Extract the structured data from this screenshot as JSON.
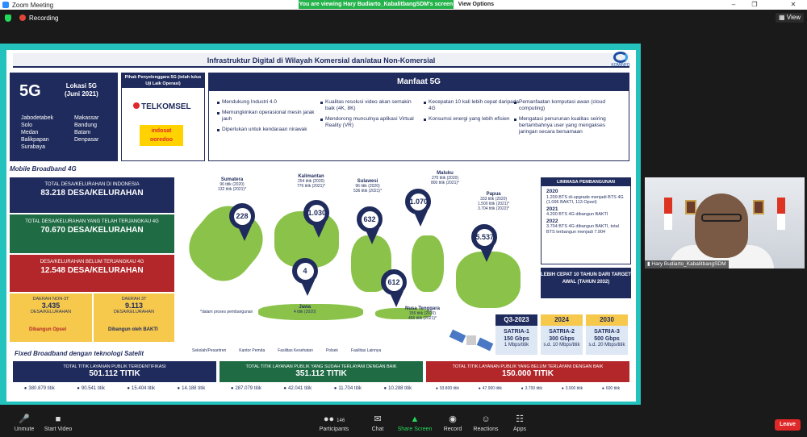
{
  "window": {
    "title": "Zoom Meeting"
  },
  "topbar": {
    "recording_label": "Recording",
    "view_label": "View"
  },
  "banner": {
    "viewing_text": "You are viewing Hary Budiarto_KabalitbangSDM's screen",
    "view_options_label": "View Options"
  },
  "slide": {
    "title": "Infrastruktur Digital di Wilayah Komersial dan/atau Non-Komersial",
    "logo_text": "KOMINFO",
    "fiveg": {
      "big": "5G",
      "lokasi": "Lokasi 5G",
      "date": "(Juni 2021)",
      "cities_left": [
        "Jabodetabek",
        "Solo",
        "Medan",
        "Balikpapan",
        "Surabaya"
      ],
      "cities_right": [
        "Makassar",
        "Bandung",
        "Batam",
        "Denpasar"
      ]
    },
    "operators": {
      "header": "Pihak Penyelenggara 5G (telah lulus Uji Laik Operasi)",
      "op1": "TELKOMSEL",
      "op2a": "indosat",
      "op2b": "ooredoo"
    },
    "manfaat": {
      "header": "Manfaat 5G",
      "col1": [
        "Mendukung Industri 4.0",
        "Memungkinkan operasional mesin jarak jauh",
        "Diperlukan untuk kendaraan nirawak"
      ],
      "col2": [
        "Kualitas resolusi video akan semakin baik (4K, 8K)",
        "Mendorong munculnya aplikasi Virtual Reality (VR)"
      ],
      "col3": [
        "Kecepatan 10 kali lebih cepat daripada 4G",
        "Konsumsi energi yang lebih efisien"
      ],
      "col4": [
        "Pemanfaatan komputasi awan (cloud computing)",
        "Mengatasi penurunan kualitas seiring bertambahnya user yang mengakses jaringan secara bersamaan"
      ]
    },
    "mobile_title": "Mobile Broadband 4G",
    "stats": [
      {
        "label": "TOTAL DESA/KELURAHAN DI INDONESIA",
        "value": "83.218 DESA/KELURAHAN"
      },
      {
        "label": "TOTAL DESA/KELURAHAN YANG TELAH TERJANGKAU 4G",
        "value": "70.670 DESA/KELURAHAN"
      },
      {
        "label": "DESA/KELURAHAN BELUM TERJANGKAU 4G",
        "value": "12.548 DESA/KELURAHAN"
      }
    ],
    "sub": {
      "non3t_label": "DAERAH NON-3T",
      "non3t_value": "3.435",
      "non3t_unit": "DESA/KELURAHAN",
      "non3t_note": "Dibangun Opsel",
      "t3_label": "DAERAH 3T",
      "t3_value": "9.113",
      "t3_unit": "DESA/KELURAHAN",
      "t3_note": "Dibangun oleh BAKTI"
    },
    "regions": [
      {
        "name": "Sumatera",
        "l1": "96 titik (2020)",
        "l2": "132 titik (2021)*",
        "pin": "228"
      },
      {
        "name": "Kalimantan",
        "l1": "254 titik (2020)",
        "l2": "776 titik (2021)*",
        "pin": "1.030"
      },
      {
        "name": "Sulawesi",
        "l1": "96 titik (2020)",
        "l2": "536 titik (2021)*",
        "pin": "632"
      },
      {
        "name": "Maluku",
        "l1": "270 titik (2020)",
        "l2": "800 titik (2021)*",
        "pin": "1.070"
      },
      {
        "name": "Papua",
        "l1": "333 titik (2020)",
        "l2": "1.500 titik (2021)*",
        "l3": "3.704 titik (2022)*",
        "pin": "5.537"
      },
      {
        "name": "Jawa",
        "l1": "4 titik (2020)",
        "pin": "4"
      },
      {
        "name": "Nusa Tenggara",
        "l1": "156 titik (2020)",
        "l2": "456 titik (2021)*",
        "pin": "612"
      }
    ],
    "dalam": "*dalam proses pembangunan",
    "timeline": {
      "header": "LINIMASA PEMBANGUNAN",
      "y1": "2020",
      "t1": "1.209 BTS di-upgrade menjadi BTS 4G (1.096 BAKTI, 113 Opsel)",
      "y2": "2021",
      "t2": "4.200 BTS 4G dibangun BAKTI",
      "y3": "2022",
      "t3": "3.704 BTS 4G dibangun BAKTI, total BTS terbangun menjadi 7.904"
    },
    "lebih": "LEBIH CEPAT 10 TAHUN DARI TARGET AWAL (TAHUN 2032)",
    "satria": [
      {
        "year": "Q3-2023",
        "name": "SATRIA-1",
        "cap": "150 Gbps",
        "note": "1 Mbps/titik"
      },
      {
        "year": "2024",
        "name": "SATRIA-2",
        "cap": "300 Gbps",
        "note": "s.d. 10 Mbps/titik"
      },
      {
        "year": "2030",
        "name": "SATRIA-3",
        "cap": "500 Gbps",
        "note": "s.d. 20 Mbps/titik"
      }
    ],
    "legend": [
      "Sekolah/Pesantren",
      "Kantor Pemda",
      "Fasilitas Kesehatan",
      "Polsek",
      "Fasilitas Lainnya"
    ],
    "fixed_title": "Fixed Broadband dengan teknologi Satelit",
    "fixed": [
      {
        "label": "TOTAL TITIK LAYANAN PUBLIK TERIDENTIFIKASI",
        "value": "501.112 TITIK",
        "items": [
          "380.879 titik",
          "90.541 titik",
          "15.404 titik",
          "14.188 titik"
        ]
      },
      {
        "label": "TOTAL TITIK LAYANAN PUBLIK YANG SUDAH TERLAYANI DENGAN BAIK",
        "value": "351.112 TITIK",
        "items": [
          "287.079 titik",
          "42.041 titik",
          "11.704 titik",
          "10.288 titik"
        ]
      },
      {
        "label": "TOTAL TITIK LAYANAN PUBLIK YANG BELUM TERLAYANI DENGAN BAIK",
        "value": "150.000 TITIK",
        "items": [
          "93.800 titik",
          "47.900 titik",
          "3.700 titik",
          "3.900 titik",
          "600 titik"
        ]
      }
    ]
  },
  "video": {
    "name": "Hary Budiarto_KabalitbangSDM"
  },
  "toolbar": {
    "unmute": "Unmute",
    "start_video": "Start Video",
    "participants": "Participants",
    "participants_count": "146",
    "chat": "Chat",
    "share": "Share Screen",
    "record": "Record",
    "reactions": "Reactions",
    "apps": "Apps",
    "leave": "Leave"
  }
}
